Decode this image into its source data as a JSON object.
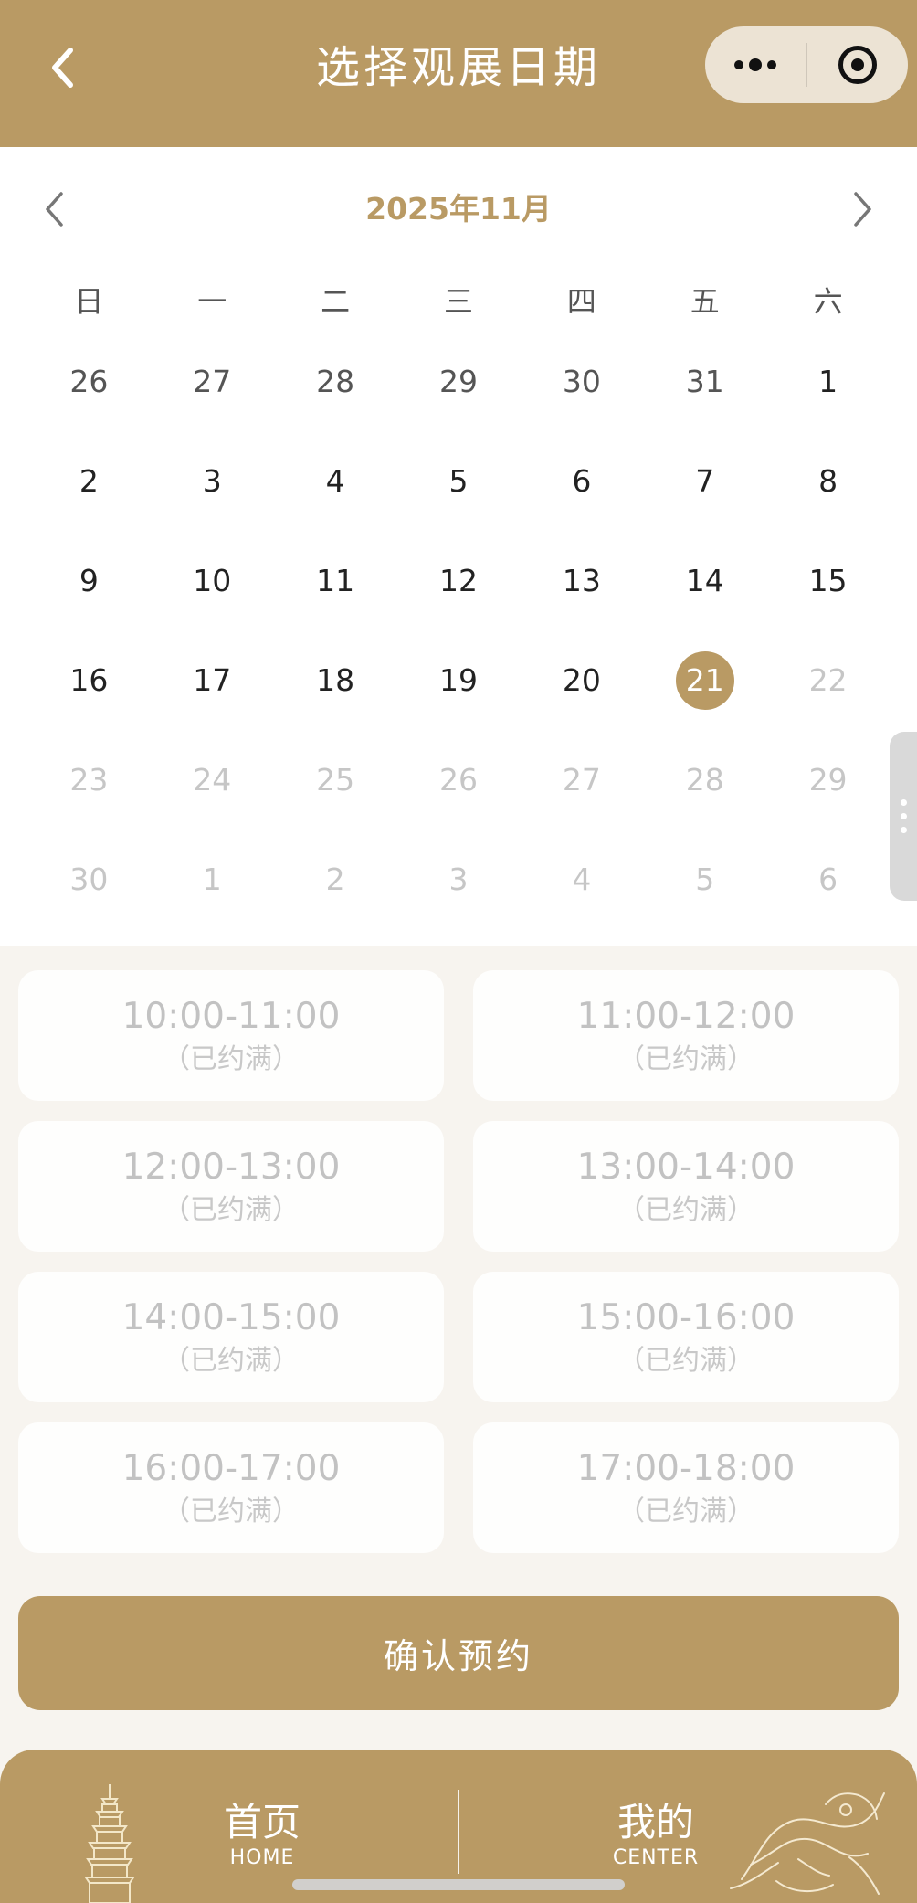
{
  "header": {
    "title": "选择观展日期",
    "back_icon": "chevron-left-icon",
    "more_icon": "more-dots-icon",
    "target_icon": "target-icon"
  },
  "calendar": {
    "month_label": "2025年11月",
    "prev_icon": "chevron-left-icon",
    "next_icon": "chevron-right-icon",
    "weekdays": [
      "日",
      "一",
      "二",
      "三",
      "四",
      "五",
      "六"
    ],
    "days": [
      {
        "label": "26",
        "state": "prev-month"
      },
      {
        "label": "27",
        "state": "prev-month"
      },
      {
        "label": "28",
        "state": "prev-month"
      },
      {
        "label": "29",
        "state": "prev-month"
      },
      {
        "label": "30",
        "state": "prev-month"
      },
      {
        "label": "31",
        "state": "prev-month"
      },
      {
        "label": "1",
        "state": "normal"
      },
      {
        "label": "2",
        "state": "normal"
      },
      {
        "label": "3",
        "state": "normal"
      },
      {
        "label": "4",
        "state": "normal"
      },
      {
        "label": "5",
        "state": "normal"
      },
      {
        "label": "6",
        "state": "normal"
      },
      {
        "label": "7",
        "state": "normal"
      },
      {
        "label": "8",
        "state": "normal"
      },
      {
        "label": "9",
        "state": "normal"
      },
      {
        "label": "10",
        "state": "normal"
      },
      {
        "label": "11",
        "state": "normal"
      },
      {
        "label": "12",
        "state": "normal"
      },
      {
        "label": "13",
        "state": "normal"
      },
      {
        "label": "14",
        "state": "normal"
      },
      {
        "label": "15",
        "state": "normal"
      },
      {
        "label": "16",
        "state": "normal"
      },
      {
        "label": "17",
        "state": "normal"
      },
      {
        "label": "18",
        "state": "normal"
      },
      {
        "label": "19",
        "state": "normal"
      },
      {
        "label": "20",
        "state": "normal"
      },
      {
        "label": "21",
        "state": "selected"
      },
      {
        "label": "22",
        "state": "disabled"
      },
      {
        "label": "23",
        "state": "disabled"
      },
      {
        "label": "24",
        "state": "disabled"
      },
      {
        "label": "25",
        "state": "disabled"
      },
      {
        "label": "26",
        "state": "disabled"
      },
      {
        "label": "27",
        "state": "disabled"
      },
      {
        "label": "28",
        "state": "disabled"
      },
      {
        "label": "29",
        "state": "disabled"
      },
      {
        "label": "30",
        "state": "disabled"
      },
      {
        "label": "1",
        "state": "disabled"
      },
      {
        "label": "2",
        "state": "disabled"
      },
      {
        "label": "3",
        "state": "disabled"
      },
      {
        "label": "4",
        "state": "disabled"
      },
      {
        "label": "5",
        "state": "disabled"
      },
      {
        "label": "6",
        "state": "disabled"
      }
    ]
  },
  "time_slots": [
    {
      "time": "10:00-11:00",
      "status": "（已约满）"
    },
    {
      "time": "11:00-12:00",
      "status": "（已约满）"
    },
    {
      "time": "12:00-13:00",
      "status": "（已约满）"
    },
    {
      "time": "13:00-14:00",
      "status": "（已约满）"
    },
    {
      "time": "14:00-15:00",
      "status": "（已约满）"
    },
    {
      "time": "15:00-16:00",
      "status": "（已约满）"
    },
    {
      "time": "16:00-17:00",
      "status": "（已约满）"
    },
    {
      "time": "17:00-18:00",
      "status": "（已约满）"
    }
  ],
  "confirm_button": "确认预约",
  "bottom_nav": {
    "home_cn": "首页",
    "home_en": "HOME",
    "center_cn": "我的",
    "center_en": "CENTER",
    "pagoda_icon": "pagoda-icon",
    "dragon_icon": "dragon-decoration-icon"
  },
  "colors": {
    "brand_gold": "#b99a64",
    "selected_day_bg": "#b99a64",
    "background": "#f7f4ef"
  }
}
